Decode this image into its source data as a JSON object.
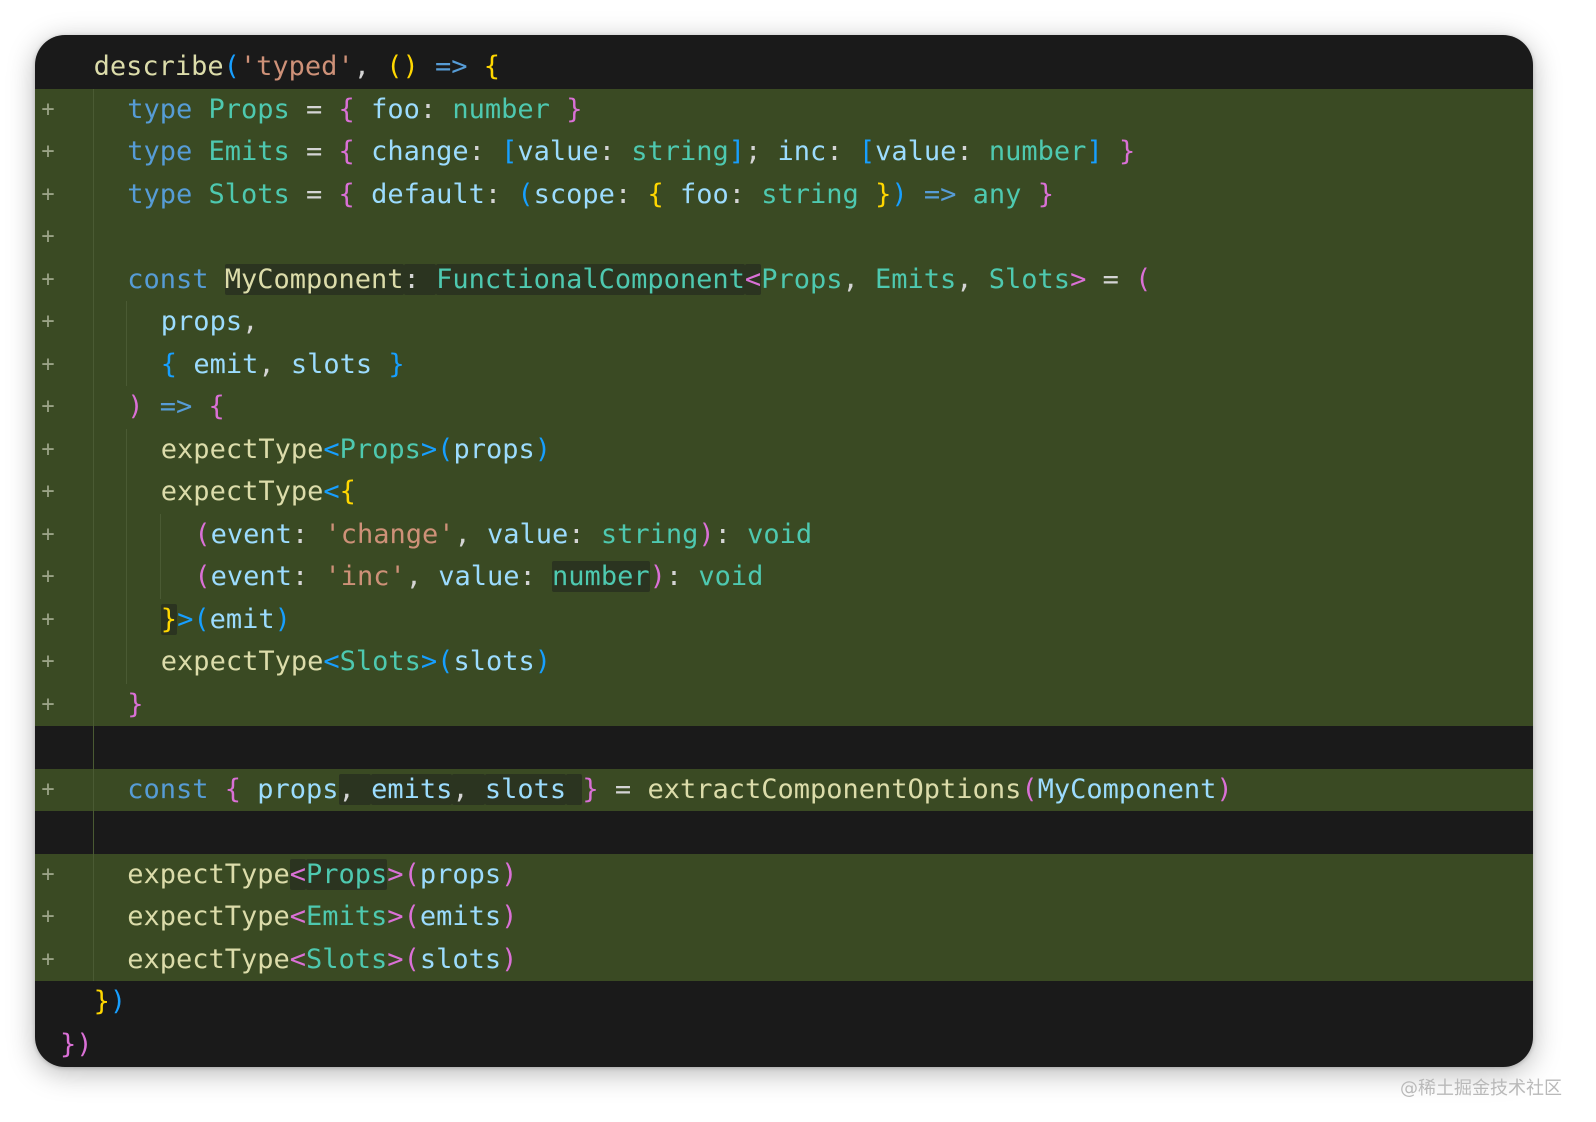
{
  "editor": {
    "diff_marker": "+",
    "lines": [
      {
        "indent": 2,
        "added": false,
        "tokens": [
          [
            "describe",
            "fn"
          ],
          [
            "(",
            "b3"
          ],
          [
            "'typed'",
            "s"
          ],
          [
            ", ",
            "p"
          ],
          [
            "()",
            "b1"
          ],
          [
            " ",
            "p"
          ],
          [
            "=>",
            "k"
          ],
          [
            " ",
            "p"
          ],
          [
            "{",
            "b1"
          ]
        ]
      },
      {
        "indent": 4,
        "added": true,
        "tokens": [
          [
            "type",
            "k"
          ],
          [
            " ",
            "p"
          ],
          [
            "Props",
            "ty"
          ],
          [
            " = ",
            "p"
          ],
          [
            "{",
            "b2"
          ],
          [
            " ",
            "p"
          ],
          [
            "foo",
            "v"
          ],
          [
            ": ",
            "p"
          ],
          [
            "number",
            "ty"
          ],
          [
            " ",
            "p"
          ],
          [
            "}",
            "b2"
          ]
        ]
      },
      {
        "indent": 4,
        "added": true,
        "tokens": [
          [
            "type",
            "k"
          ],
          [
            " ",
            "p"
          ],
          [
            "Emits",
            "ty"
          ],
          [
            " = ",
            "p"
          ],
          [
            "{",
            "b2"
          ],
          [
            " ",
            "p"
          ],
          [
            "change",
            "v"
          ],
          [
            ": ",
            "p"
          ],
          [
            "[",
            "b3"
          ],
          [
            "value",
            "v"
          ],
          [
            ": ",
            "p"
          ],
          [
            "string",
            "ty"
          ],
          [
            "]",
            "b3"
          ],
          [
            "; ",
            "p"
          ],
          [
            "inc",
            "v"
          ],
          [
            ": ",
            "p"
          ],
          [
            "[",
            "b3"
          ],
          [
            "value",
            "v"
          ],
          [
            ": ",
            "p"
          ],
          [
            "number",
            "ty"
          ],
          [
            "]",
            "b3"
          ],
          [
            " ",
            "p"
          ],
          [
            "}",
            "b2"
          ]
        ]
      },
      {
        "indent": 4,
        "added": true,
        "tokens": [
          [
            "type",
            "k"
          ],
          [
            " ",
            "p"
          ],
          [
            "Slots",
            "ty"
          ],
          [
            " = ",
            "p"
          ],
          [
            "{",
            "b2"
          ],
          [
            " ",
            "p"
          ],
          [
            "default",
            "v"
          ],
          [
            ": ",
            "p"
          ],
          [
            "(",
            "b3"
          ],
          [
            "scope",
            "v"
          ],
          [
            ": ",
            "p"
          ],
          [
            "{",
            "b1"
          ],
          [
            " ",
            "p"
          ],
          [
            "foo",
            "v"
          ],
          [
            ": ",
            "p"
          ],
          [
            "string",
            "ty"
          ],
          [
            " ",
            "p"
          ],
          [
            "}",
            "b1"
          ],
          [
            ")",
            "b3"
          ],
          [
            " ",
            "p"
          ],
          [
            "=>",
            "k"
          ],
          [
            " ",
            "p"
          ],
          [
            "any",
            "ty"
          ],
          [
            " ",
            "p"
          ],
          [
            "}",
            "b2"
          ]
        ]
      },
      {
        "indent": 0,
        "added": true,
        "tokens": []
      },
      {
        "indent": 4,
        "added": true,
        "tokens": [
          [
            "const",
            "k"
          ],
          [
            " ",
            "p"
          ],
          [
            "MyComponent",
            "fn",
            "hl"
          ],
          [
            ": ",
            "p",
            "hl"
          ],
          [
            "FunctionalComponent",
            "ty",
            "hl"
          ],
          [
            "<",
            "b2",
            "hl"
          ],
          [
            "Props",
            "ty"
          ],
          [
            ", ",
            "p"
          ],
          [
            "Emits",
            "ty"
          ],
          [
            ", ",
            "p"
          ],
          [
            "Slots",
            "ty"
          ],
          [
            ">",
            "b2"
          ],
          [
            " = ",
            "p"
          ],
          [
            "(",
            "b2"
          ]
        ]
      },
      {
        "indent": 6,
        "added": true,
        "tokens": [
          [
            "props",
            "v"
          ],
          [
            ",",
            "p"
          ]
        ]
      },
      {
        "indent": 6,
        "added": true,
        "tokens": [
          [
            "{",
            "b3"
          ],
          [
            " ",
            "p"
          ],
          [
            "emit",
            "v"
          ],
          [
            ", ",
            "p"
          ],
          [
            "slots",
            "v"
          ],
          [
            " ",
            "p"
          ],
          [
            "}",
            "b3"
          ]
        ]
      },
      {
        "indent": 4,
        "added": true,
        "tokens": [
          [
            ")",
            "b2"
          ],
          [
            " ",
            "p"
          ],
          [
            "=>",
            "k"
          ],
          [
            " ",
            "p"
          ],
          [
            "{",
            "b2"
          ]
        ]
      },
      {
        "indent": 6,
        "added": true,
        "tokens": [
          [
            "expectType",
            "fn"
          ],
          [
            "<",
            "b3"
          ],
          [
            "Props",
            "ty"
          ],
          [
            ">",
            "b3"
          ],
          [
            "(",
            "b3"
          ],
          [
            "props",
            "v"
          ],
          [
            ")",
            "b3"
          ]
        ]
      },
      {
        "indent": 6,
        "added": true,
        "tokens": [
          [
            "expectType",
            "fn"
          ],
          [
            "<",
            "b3"
          ],
          [
            "{",
            "b1"
          ]
        ]
      },
      {
        "indent": 8,
        "added": true,
        "tokens": [
          [
            "(",
            "b2"
          ],
          [
            "event",
            "v"
          ],
          [
            ": ",
            "p"
          ],
          [
            "'change'",
            "s"
          ],
          [
            ", ",
            "p"
          ],
          [
            "value",
            "v"
          ],
          [
            ": ",
            "p"
          ],
          [
            "string",
            "ty"
          ],
          [
            ")",
            "b2"
          ],
          [
            ": ",
            "p"
          ],
          [
            "void",
            "ty"
          ]
        ]
      },
      {
        "indent": 8,
        "added": true,
        "tokens": [
          [
            "(",
            "b2"
          ],
          [
            "event",
            "v"
          ],
          [
            ": ",
            "p"
          ],
          [
            "'inc'",
            "s"
          ],
          [
            ", ",
            "p"
          ],
          [
            "value",
            "v"
          ],
          [
            ": ",
            "p"
          ],
          [
            "number",
            "ty",
            "hl"
          ],
          [
            ")",
            "b2"
          ],
          [
            ": ",
            "p"
          ],
          [
            "void",
            "ty"
          ]
        ]
      },
      {
        "indent": 6,
        "added": true,
        "tokens": [
          [
            "}",
            "b1",
            "hl"
          ],
          [
            ">",
            "b3"
          ],
          [
            "(",
            "b3"
          ],
          [
            "emit",
            "v"
          ],
          [
            ")",
            "b3"
          ]
        ]
      },
      {
        "indent": 6,
        "added": true,
        "tokens": [
          [
            "expectType",
            "fn"
          ],
          [
            "<",
            "b3"
          ],
          [
            "Slots",
            "ty"
          ],
          [
            ">",
            "b3"
          ],
          [
            "(",
            "b3"
          ],
          [
            "slots",
            "v"
          ],
          [
            ")",
            "b3"
          ]
        ]
      },
      {
        "indent": 4,
        "added": true,
        "tokens": [
          [
            "}",
            "b2"
          ]
        ]
      },
      {
        "indent": 0,
        "added": false,
        "tokens": []
      },
      {
        "indent": 4,
        "added": true,
        "tokens": [
          [
            "const",
            "k"
          ],
          [
            " ",
            "p"
          ],
          [
            "{",
            "b2"
          ],
          [
            " ",
            "p"
          ],
          [
            "props",
            "v"
          ],
          [
            ", ",
            "p",
            "hl"
          ],
          [
            "emits",
            "v",
            "hl"
          ],
          [
            ", ",
            "p",
            "hl"
          ],
          [
            "slots",
            "v",
            "hl"
          ],
          [
            " ",
            "p",
            "hl"
          ],
          [
            "}",
            "b2"
          ],
          [
            " = ",
            "p"
          ],
          [
            "extractComponentOptions",
            "fn"
          ],
          [
            "(",
            "b2"
          ],
          [
            "MyComponent",
            "v"
          ],
          [
            ")",
            "b2"
          ]
        ]
      },
      {
        "indent": 0,
        "added": false,
        "tokens": []
      },
      {
        "indent": 4,
        "added": true,
        "tokens": [
          [
            "expectType",
            "fn"
          ],
          [
            "<",
            "b2",
            "hl"
          ],
          [
            "Props",
            "ty",
            "hl"
          ],
          [
            ">",
            "b2"
          ],
          [
            "(",
            "b2"
          ],
          [
            "props",
            "v"
          ],
          [
            ")",
            "b2"
          ]
        ]
      },
      {
        "indent": 4,
        "added": true,
        "tokens": [
          [
            "expectType",
            "fn"
          ],
          [
            "<",
            "b2"
          ],
          [
            "Emits",
            "ty"
          ],
          [
            ">",
            "b2"
          ],
          [
            "(",
            "b2"
          ],
          [
            "emits",
            "v"
          ],
          [
            ")",
            "b2"
          ]
        ]
      },
      {
        "indent": 4,
        "added": true,
        "tokens": [
          [
            "expectType",
            "fn"
          ],
          [
            "<",
            "b2"
          ],
          [
            "Slots",
            "ty"
          ],
          [
            ">",
            "b2"
          ],
          [
            "(",
            "b2"
          ],
          [
            "slots",
            "v"
          ],
          [
            ")",
            "b2"
          ]
        ]
      },
      {
        "indent": 2,
        "added": false,
        "tokens": [
          [
            "}",
            "b1"
          ],
          [
            ")",
            "b3"
          ]
        ]
      },
      {
        "indent": 0,
        "added": false,
        "tokens": [
          [
            "})",
            "b2"
          ]
        ]
      }
    ],
    "syntax_colors": {
      "keyword": "#569cd6",
      "type": "#4ec9b0",
      "function": "#dcdcaa",
      "variable": "#9cdcfe",
      "string": "#ce9178",
      "bracket_gold": "#ffd700",
      "bracket_pink": "#da70d6",
      "bracket_blue": "#179fff",
      "added_line_bg": "#3a4a23",
      "editor_bg": "#1a1a1a"
    }
  },
  "watermark": "@稀土掘金技术社区"
}
